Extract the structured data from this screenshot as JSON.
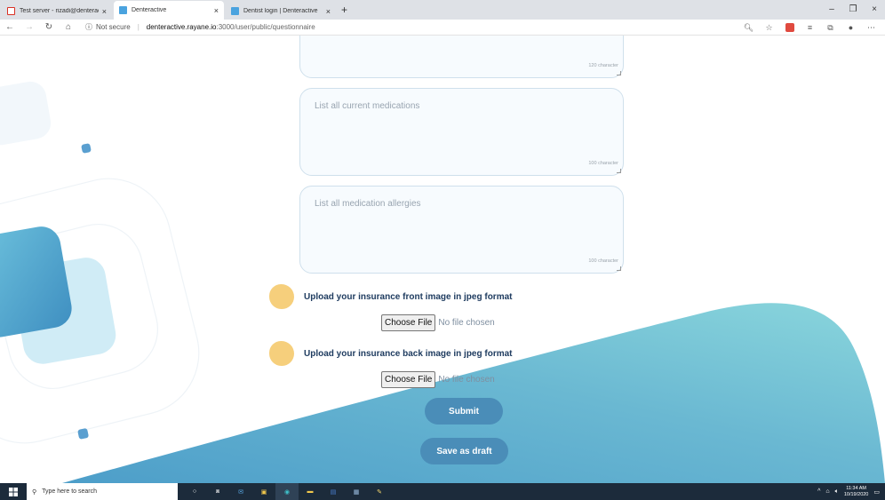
{
  "browser": {
    "tabs": [
      {
        "title": "Test server - rizadi@denteractive",
        "close": "×",
        "favicon_color": "#d93025",
        "active": false
      },
      {
        "title": "Denteractive",
        "close": "×",
        "favicon_color": "#4aa3df",
        "active": true
      },
      {
        "title": "Dentist login | Denteractive",
        "close": "×",
        "favicon_color": "#4aa3df",
        "active": false
      }
    ],
    "new_tab_label": "+",
    "window_controls": [
      "–",
      "❐",
      "×"
    ],
    "address": {
      "security_label": "Not secure",
      "host": "denteractive.rayane.io",
      "path": ":3000/user/public/questionnaire"
    }
  },
  "form": {
    "fields": [
      {
        "placeholder": "",
        "counter": "120 character"
      },
      {
        "placeholder": "List all current medications",
        "counter": "100 character"
      },
      {
        "placeholder": "List all medication allergies",
        "counter": "100 character"
      }
    ],
    "uploads": [
      {
        "label": "Upload your insurance front image in jpeg format",
        "button": "Choose File",
        "status": "No file chosen"
      },
      {
        "label": "Upload your insurance back image in jpeg format",
        "button": "Choose File",
        "status": "No file chosen"
      }
    ],
    "submit_label": "Submit",
    "draft_label": "Save as draft"
  },
  "taskbar": {
    "search_placeholder": "Type here to search",
    "time": "11:34 AM",
    "date": "10/19/2020"
  },
  "colors": {
    "accent": "#4a8db8",
    "wave_light": "#86d3da",
    "wave_dark": "#4d9ec9",
    "blob": "#f6cf7c",
    "heading": "#1f3c60"
  }
}
